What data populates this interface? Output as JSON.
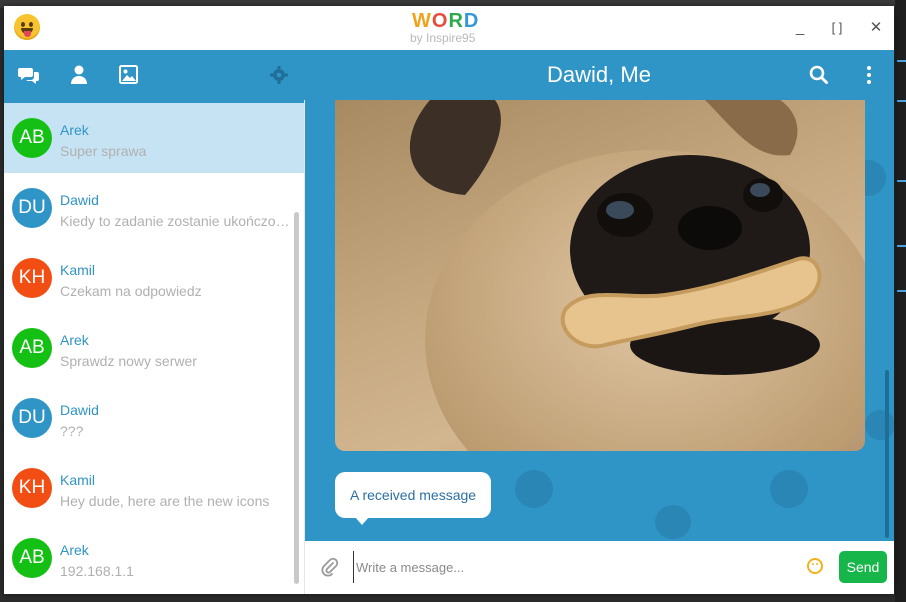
{
  "app": {
    "logo_text": "WORD",
    "logo_letters": [
      "W",
      "O",
      "R",
      "D"
    ],
    "logo_sub": "by Inspire95"
  },
  "window_controls": {
    "minimize": "_",
    "maximize": "[ ]",
    "close": "✕"
  },
  "colors": {
    "header_blue": "#2f94c6",
    "active_row": "#c6e3f3",
    "send_green": "#16b64a",
    "name_blue": "#2f94c6"
  },
  "header": {
    "chat_title": "Dawid, Me",
    "left_icons": [
      "chat-bubbles-icon",
      "user-icon",
      "image-icon",
      "gear-icon"
    ],
    "right_icons": [
      "search-icon",
      "more-vertical-icon"
    ]
  },
  "conversations": [
    {
      "initials": "AB",
      "name": "Arek",
      "preview": "Super sprawa",
      "color": "#14c014",
      "active": true
    },
    {
      "initials": "DU",
      "name": "Dawid",
      "preview": "Kiedy to zadanie zostanie ukończone?",
      "color": "#2f94c6",
      "active": false
    },
    {
      "initials": "KH",
      "name": "Kamil",
      "preview": "Czekam na odpowiedz",
      "color": "#f24d12",
      "active": false
    },
    {
      "initials": "AB",
      "name": "Arek",
      "preview": "Sprawdz nowy serwer",
      "color": "#14c014",
      "active": false
    },
    {
      "initials": "DU",
      "name": "Dawid",
      "preview": "???",
      "color": "#2f94c6",
      "active": false
    },
    {
      "initials": "KH",
      "name": "Kamil",
      "preview": "Hey dude, here are the new icons",
      "color": "#f24d12",
      "active": false
    },
    {
      "initials": "AB",
      "name": "Arek",
      "preview": "192.168.1.1",
      "color": "#14c014",
      "active": false
    }
  ],
  "chat": {
    "image_subject": "pug-with-bone",
    "received_message": "A received message"
  },
  "composer": {
    "placeholder": "Write a message...",
    "send_label": "Send"
  }
}
